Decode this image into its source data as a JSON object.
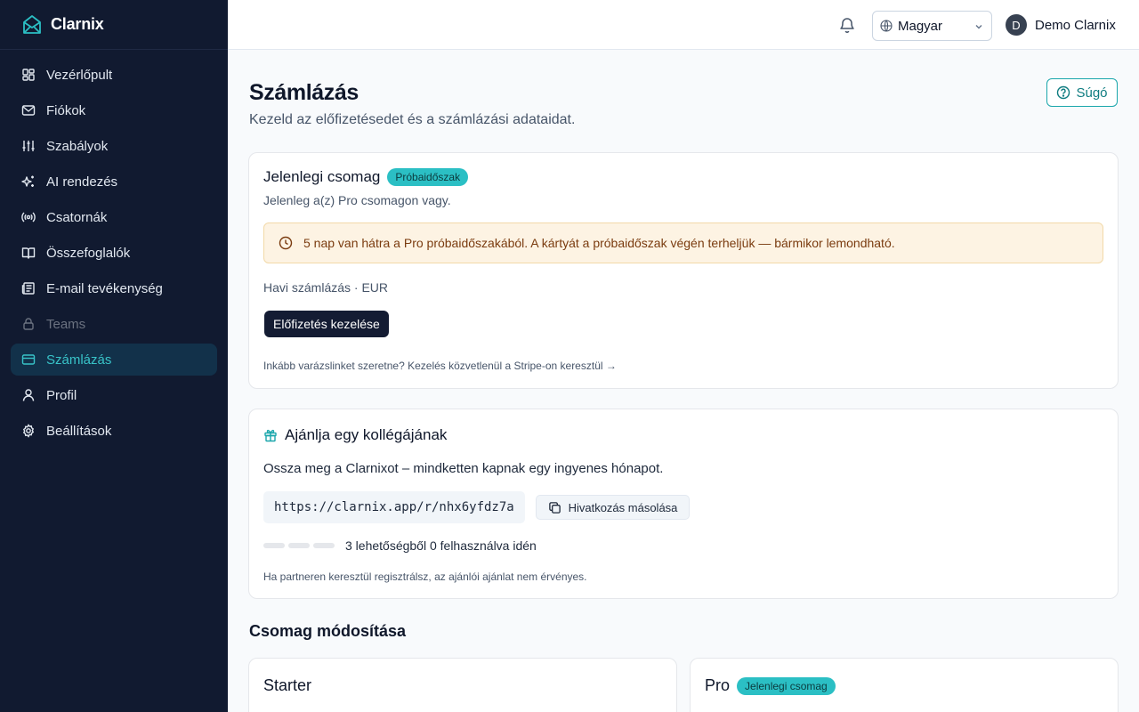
{
  "brand": {
    "name": "Clarnix"
  },
  "sidebar": {
    "items": [
      {
        "label": "Vezérlőpult",
        "icon": "dashboard-icon"
      },
      {
        "label": "Fiókok",
        "icon": "mail-icon"
      },
      {
        "label": "Szabályok",
        "icon": "sliders-icon"
      },
      {
        "label": "AI rendezés",
        "icon": "sparkles-icon"
      },
      {
        "label": "Csatornák",
        "icon": "radio-icon"
      },
      {
        "label": "Összefoglalók",
        "icon": "book-icon"
      },
      {
        "label": "E-mail tevékenység",
        "icon": "newspaper-icon"
      },
      {
        "label": "Teams",
        "icon": "lock-icon"
      },
      {
        "label": "Számlázás",
        "icon": "credit-card-icon"
      },
      {
        "label": "Profil",
        "icon": "user-icon"
      },
      {
        "label": "Beállítások",
        "icon": "gear-icon"
      }
    ]
  },
  "header": {
    "language": "Magyar",
    "user_initial": "D",
    "user_name": "Demo Clarnix"
  },
  "page": {
    "title": "Számlázás",
    "subtitle": "Kezeld az előfizetésedet és a számlázási adataidat.",
    "help_label": "Súgó"
  },
  "current_plan": {
    "title": "Jelenlegi csomag",
    "badge": "Próbaidőszak",
    "subtitle": "Jelenleg a(z) Pro csomagon vagy.",
    "alert": "5 nap van hátra a Pro próbaidőszakából. A kártyát a próbaidőszak végén terheljük — bármikor lemondható.",
    "billing": "Havi számlázás · EUR",
    "manage_label": "Előfizetés kezelése",
    "magic_link": "Inkább varázslinket szeretne? Kezelés közvetlenül a Stripe-on keresztül →"
  },
  "referral": {
    "title": "Ajánlja egy kollégájának",
    "description": "Ossza meg a Clarnixot – mindketten kapnak egy ingyenes hónapot.",
    "link": "https://clarnix.app/r/nhx6yfdz7a",
    "copy_label": "Hivatkozás másolása",
    "usage_total": 3,
    "usage_used": 0,
    "usage_text": "3 lehetőségből 0 felhasználva idén",
    "note": "Ha partneren keresztül regisztrálsz, az ajánlói ajánlat nem érvényes."
  },
  "plans": {
    "section_title": "Csomag módosítása",
    "starter_name": "Starter",
    "pro_name": "Pro",
    "pro_badge": "Jelenlegi csomag"
  },
  "colors": {
    "accent": "#2bbfc4",
    "sidebar_bg": "#111a30",
    "active_bg": "#12314a",
    "button_dark": "#141c33"
  }
}
